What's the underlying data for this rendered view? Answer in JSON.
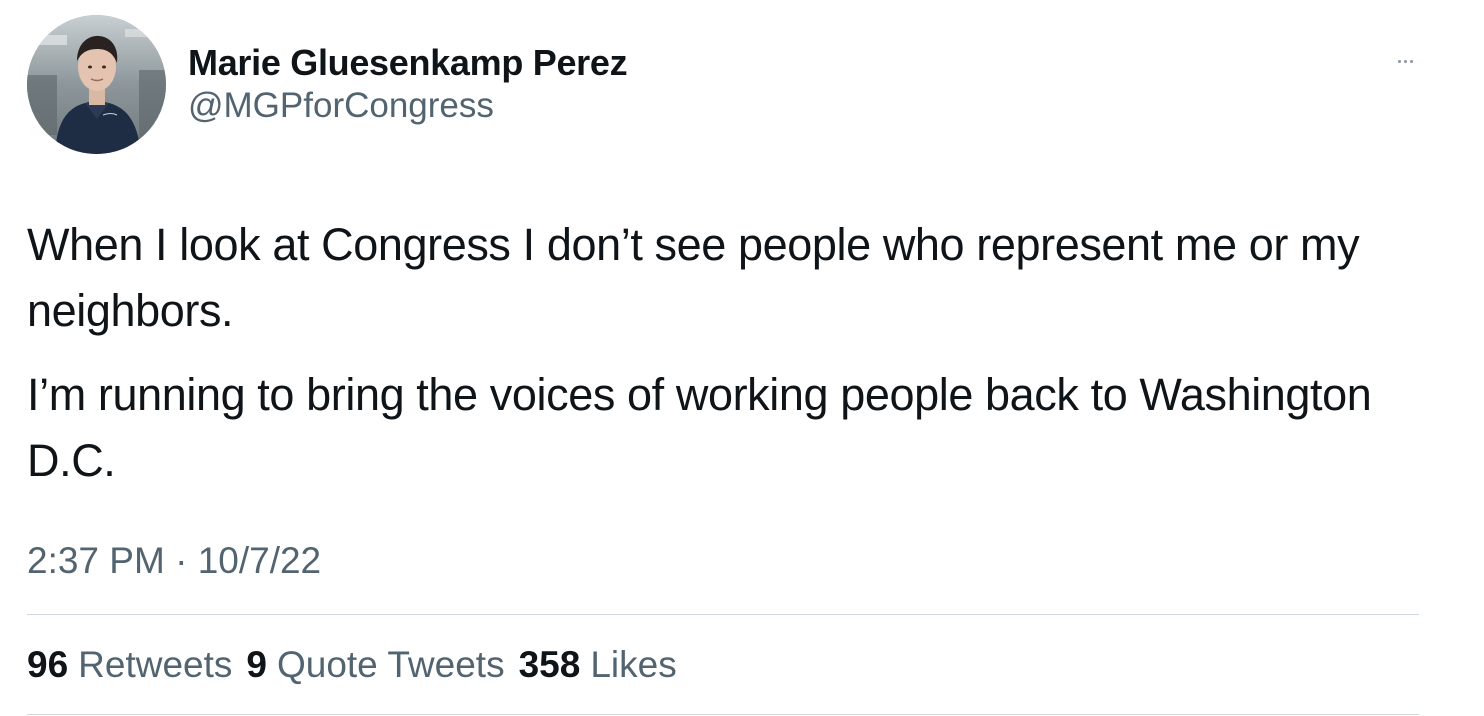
{
  "author": {
    "display_name": "Marie Gluesenkamp Perez",
    "handle": "@MGPforCongress"
  },
  "more_icon": "more-horizontal-icon",
  "tweet": {
    "paragraphs": [
      "When I look at Congress I don’t see people who represent me or my neighbors.",
      "I’m running to bring the voices of working people back to Washington D.C."
    ],
    "time": "2:37 PM",
    "separator": "·",
    "date": "10/7/22"
  },
  "stats": {
    "retweets": {
      "count": "96",
      "label": "Retweets"
    },
    "quote_tweets": {
      "count": "9",
      "label": "Quote Tweets"
    },
    "likes": {
      "count": "358",
      "label": "Likes"
    }
  },
  "colors": {
    "text_primary": "#0f1419",
    "text_secondary": "#536471",
    "divider": "#cfd9de"
  }
}
